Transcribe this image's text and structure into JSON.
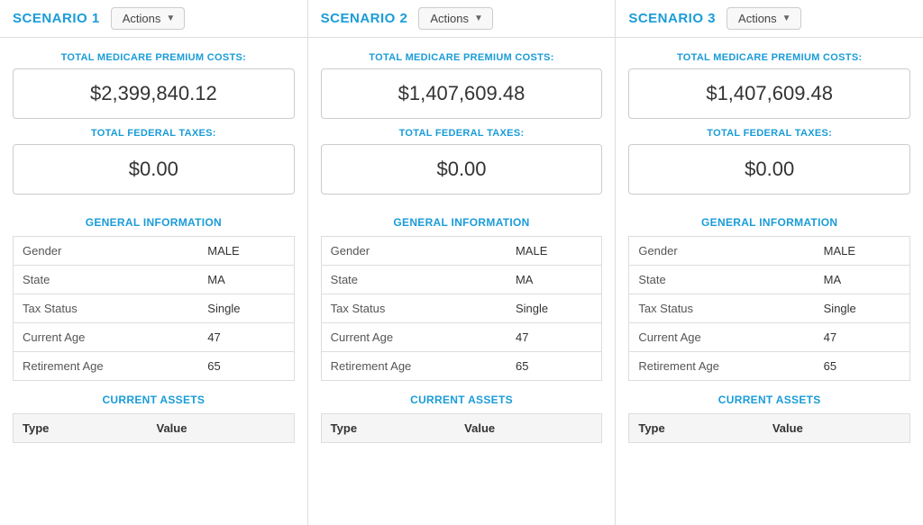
{
  "scenarios": [
    {
      "id": "scenario-1",
      "title": "SCENARIO 1",
      "actions_label": "Actions",
      "medicare_label": "TOTAL MEDICARE PREMIUM COSTS:",
      "medicare_value": "$2,399,840.12",
      "federal_label": "TOTAL FEDERAL TAXES:",
      "federal_value": "$0.00",
      "general_info_title": "GENERAL INFORMATION",
      "general_info": [
        {
          "label": "Gender",
          "value": "MALE"
        },
        {
          "label": "State",
          "value": "MA"
        },
        {
          "label": "Tax Status",
          "value": "Single"
        },
        {
          "label": "Current Age",
          "value": "47"
        },
        {
          "label": "Retirement Age",
          "value": "65"
        }
      ],
      "current_assets_title": "CURRENT ASSETS",
      "assets_columns": [
        "Type",
        "Value"
      ]
    },
    {
      "id": "scenario-2",
      "title": "SCENARIO 2",
      "actions_label": "Actions",
      "medicare_label": "TOTAL MEDICARE PREMIUM COSTS:",
      "medicare_value": "$1,407,609.48",
      "federal_label": "TOTAL FEDERAL TAXES:",
      "federal_value": "$0.00",
      "general_info_title": "GENERAL INFORMATION",
      "general_info": [
        {
          "label": "Gender",
          "value": "MALE"
        },
        {
          "label": "State",
          "value": "MA"
        },
        {
          "label": "Tax Status",
          "value": "Single"
        },
        {
          "label": "Current Age",
          "value": "47"
        },
        {
          "label": "Retirement Age",
          "value": "65"
        }
      ],
      "current_assets_title": "CURRENT ASSETS",
      "assets_columns": [
        "Type",
        "Value"
      ]
    },
    {
      "id": "scenario-3",
      "title": "SCENARIO 3",
      "actions_label": "Actions",
      "medicare_label": "TOTAL MEDICARE PREMIUM COSTS:",
      "medicare_value": "$1,407,609.48",
      "federal_label": "TOTAL FEDERAL TAXES:",
      "federal_value": "$0.00",
      "general_info_title": "GENERAL INFORMATION",
      "general_info": [
        {
          "label": "Gender",
          "value": "MALE"
        },
        {
          "label": "State",
          "value": "MA"
        },
        {
          "label": "Tax Status",
          "value": "Single"
        },
        {
          "label": "Current Age",
          "value": "47"
        },
        {
          "label": "Retirement Age",
          "value": "65"
        }
      ],
      "current_assets_title": "CURRENT ASSETS",
      "assets_columns": [
        "Type",
        "Value"
      ]
    }
  ]
}
